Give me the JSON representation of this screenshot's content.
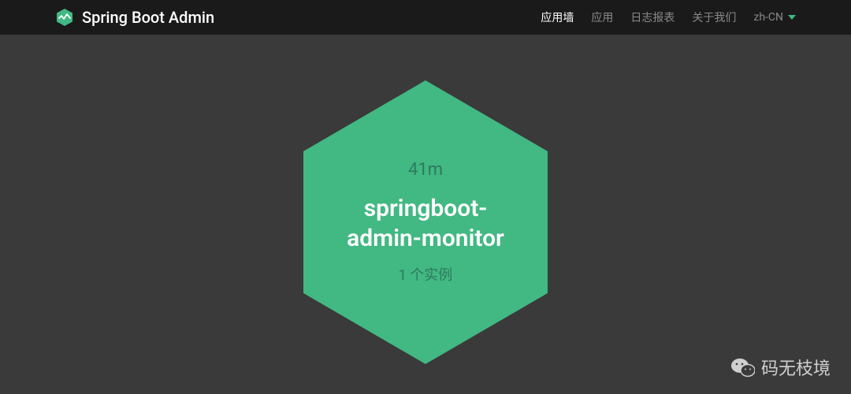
{
  "navbar": {
    "brand_title": "Spring Boot Admin",
    "items": [
      {
        "label": "应用墙",
        "active": true
      },
      {
        "label": "应用",
        "active": false
      },
      {
        "label": "日志报表",
        "active": false
      },
      {
        "label": "关于我们",
        "active": false
      }
    ],
    "language": "zh-CN"
  },
  "wallboard": {
    "apps": [
      {
        "uptime": "41m",
        "name_line1": "springboot-",
        "name_line2": "admin-monitor",
        "instance_text": "1 个实例",
        "status_color": "#42b883"
      }
    ]
  },
  "watermark": {
    "text": "码无枝境"
  }
}
